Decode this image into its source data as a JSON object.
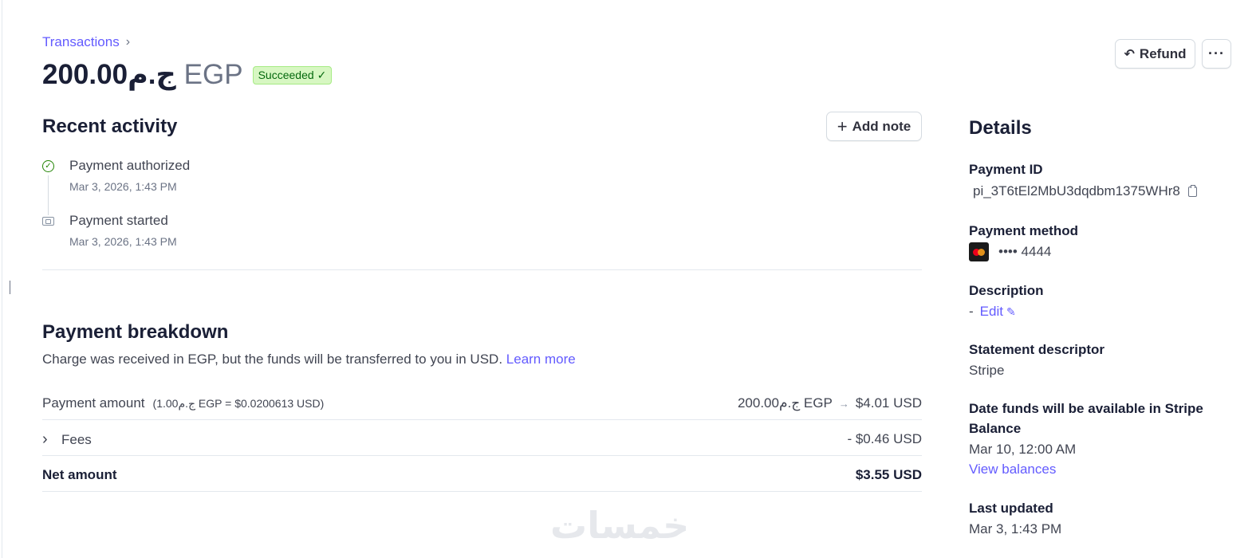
{
  "breadcrumb": {
    "link": "Transactions",
    "chevron": "›"
  },
  "header": {
    "amount": "ج.م200.00",
    "currency": "EGP",
    "status": "Succeeded",
    "status_check": "✓"
  },
  "actions": {
    "refund_label": "Refund",
    "refund_icon": "↶",
    "more_label": "···"
  },
  "recent_activity": {
    "title": "Recent activity",
    "add_note_label": "Add note",
    "add_note_icon": "+",
    "events": [
      {
        "title": "Payment authorized",
        "date": "Mar 3, 2026, 1:43 PM",
        "icon": "check-circle-icon"
      },
      {
        "title": "Payment started",
        "date": "Mar 3, 2026, 1:43 PM",
        "icon": "payment-card-icon"
      }
    ]
  },
  "breakdown": {
    "title": "Payment breakdown",
    "description": "Charge was received in EGP, but the funds will be transferred to you in USD.",
    "learn_more": "Learn more",
    "rows": {
      "payment_amount": {
        "label": "Payment amount",
        "rate": "(ج.م1.00 EGP = $0.0200613 USD)",
        "original": "ج.م200.00 EGP",
        "arrow": "→",
        "converted": "$4.01 USD"
      },
      "fees": {
        "label": "Fees",
        "chevron": "›",
        "value": "- $0.46 USD"
      },
      "net": {
        "label": "Net amount",
        "value": "$3.55 USD"
      }
    }
  },
  "details": {
    "title": "Details",
    "payment_id_label": "Payment ID",
    "payment_id": "pi_3T6tEl2MbU3dqdbm1375WHr8",
    "payment_method_label": "Payment method",
    "payment_method_value": "•••• 4444",
    "description_label": "Description",
    "description_value": "-",
    "edit_label": "Edit",
    "statement_descriptor_label": "Statement descriptor",
    "statement_descriptor": "Stripe",
    "funds_available_label": "Date funds will be available in Stripe Balance",
    "funds_available": "Mar 10, 12:00 AM",
    "view_balances": "View balances",
    "last_updated_label": "Last updated",
    "last_updated": "Mar 3, 1:43 PM"
  },
  "watermark": "خمسات",
  "colors": {
    "accent": "#635bff",
    "success_bg": "#d7f7c2",
    "success_text": "#05690d",
    "text_primary": "#1a1f36",
    "text_secondary": "#414552"
  }
}
